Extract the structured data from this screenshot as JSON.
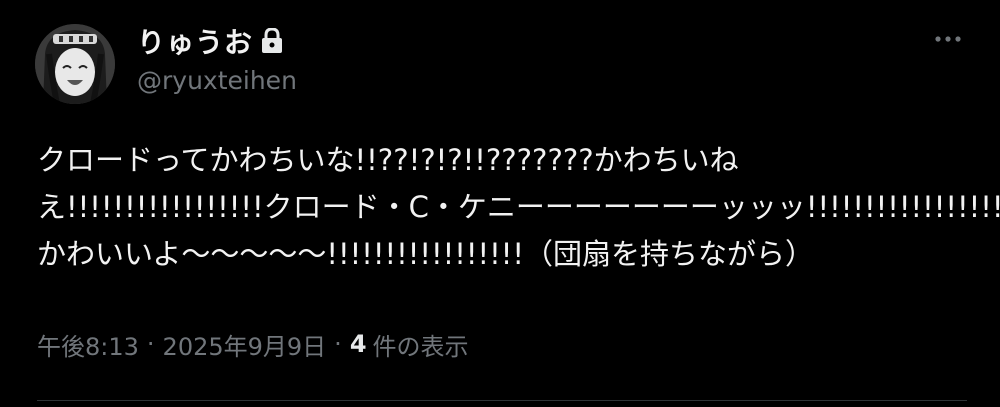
{
  "user": {
    "display_name": "りゅうお",
    "handle": "@ryuxteihen",
    "avatar_icon": "avatar-anime-character",
    "locked_icon": "lock-icon"
  },
  "header": {
    "more_icon": "more-horizontal-icon"
  },
  "tweet": {
    "lines": [
      "クロードってかわちいな!!??!?!?!!???????かわちいね",
      "え!!!!!!!!!!!!!!!!!クロード・C・ケニーーーーーーーッッッ!!!!!!!!!!!!!!!!!",
      "かわいいよ〜〜〜〜〜!!!!!!!!!!!!!!!!!（団扇を持ちながら）"
    ]
  },
  "meta": {
    "time": "午後8:13",
    "separator": "·",
    "date": "2025年9月9日",
    "views_count": "4",
    "views_label": "件の表示"
  },
  "colors": {
    "background": "#000000",
    "text_primary": "#f2f2f2",
    "text_secondary": "#71767b",
    "divider": "#2f3336"
  }
}
